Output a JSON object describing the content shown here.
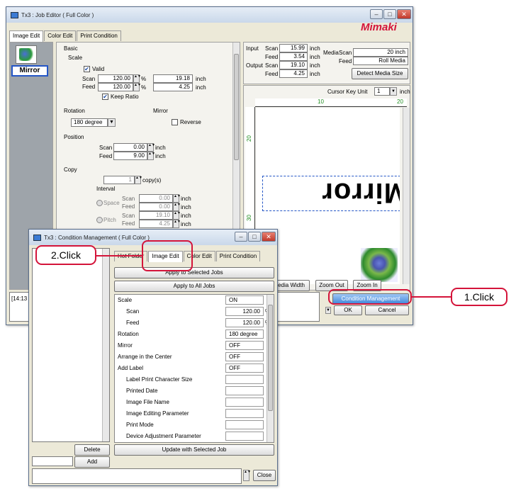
{
  "editor": {
    "title": "Tx3 : Job Editor ( Full Color )",
    "brand": "Mimaki",
    "tabs": [
      "Image Edit",
      "Color Edit",
      "Print Condition"
    ],
    "thumb_label": "Mirror",
    "basic": "Basic",
    "scale": "Scale",
    "valid": "Valid",
    "scan": "Scan",
    "feed": "Feed",
    "scale_scan_pct": "120.00",
    "scale_feed_pct": "120.00",
    "scale_scan_in": "19.18",
    "scale_feed_in": "4.25",
    "pct": "%",
    "inch": "inch",
    "keep_ratio": "Keep Ratio",
    "rotation": "Rotation",
    "rotation_val": "180 degree",
    "mirror": "Mirror",
    "reverse": "Reverse",
    "position": "Position",
    "pos_scan": "0.00",
    "pos_feed": "9.00",
    "copy": "Copy",
    "copies": "1",
    "copies_unit": "copy(s)",
    "interval": "Interval",
    "space": "Space",
    "pitch": "Pitch",
    "space_scan": "0.00",
    "space_feed": "0.00",
    "pitch_scan": "19.10",
    "pitch_feed": "4.25",
    "input": "Input",
    "output": "Output",
    "in_scan": "15.99",
    "in_feed": "3.54",
    "out_scan": "19.10",
    "out_feed": "4.25",
    "media": "Media",
    "media_scan": "20 inch",
    "media_feed": "Roll Media",
    "detect": "Detect Media Size",
    "cursor_key_unit": "Cursor Key Unit",
    "cursor_val": "1",
    "ruler_10": "10",
    "ruler_20": "20",
    "ruler_30": "30",
    "ruler_v20": "20",
    "ruler_v30": "30",
    "preview_text": "Mirror",
    "media_width": "edia Width",
    "zoom_out": "Zoom Out",
    "zoom_in": "Zoom In",
    "log": "[14:13",
    "condition_mgmt": "Condition Management",
    "ok": "OK",
    "cancel": "Cancel"
  },
  "cond": {
    "title": "Tx3 : Condition Management ( Full Color )",
    "tabs": [
      "Hot Folder",
      "Image Edit",
      "Color Edit",
      "Print Condition"
    ],
    "apply_selected": "Apply to Selected Jobs",
    "apply_all": "Apply to All Jobs",
    "rows": [
      {
        "k": "Scale",
        "v": "ON",
        "indent": 0
      },
      {
        "k": "Scan",
        "v": "120.00",
        "unit": "%",
        "indent": 1
      },
      {
        "k": "Feed",
        "v": "120.00",
        "unit": "%",
        "indent": 1
      },
      {
        "k": "Rotation",
        "v": "180 degree",
        "indent": 0
      },
      {
        "k": "Mirror",
        "v": "OFF",
        "indent": 0
      },
      {
        "k": "Arrange in the Center",
        "v": "OFF",
        "indent": 0
      },
      {
        "k": "Add Label",
        "v": "OFF",
        "indent": 0
      },
      {
        "k": "Label Print Character Size",
        "v": "",
        "indent": 1
      },
      {
        "k": "Printed Date",
        "v": "",
        "indent": 1
      },
      {
        "k": "Image File Name",
        "v": "",
        "indent": 1
      },
      {
        "k": "Image Editing Parameter",
        "v": "",
        "indent": 1
      },
      {
        "k": "Print Mode",
        "v": "",
        "indent": 1
      },
      {
        "k": "Device Adjustment Parameter",
        "v": "",
        "indent": 1
      }
    ],
    "delete": "Delete",
    "add": "Add",
    "update": "Update with Selected Job",
    "close": "Close"
  },
  "callouts": {
    "one": "1.Click",
    "two": "2.Click"
  }
}
